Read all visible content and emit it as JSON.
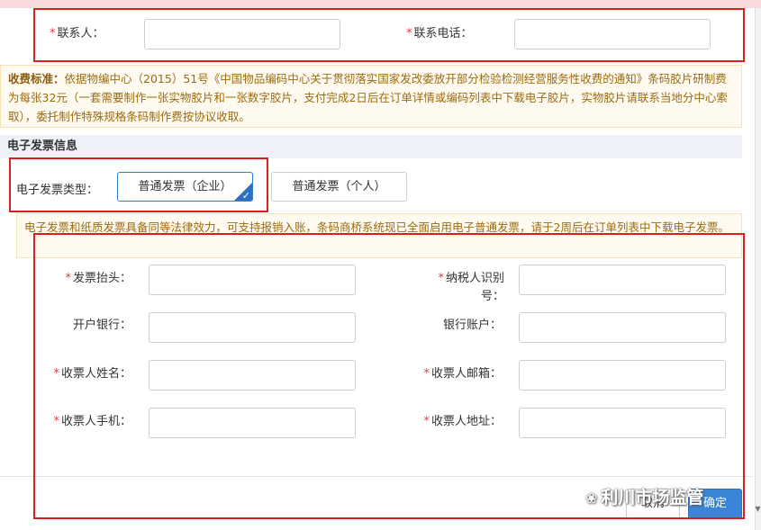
{
  "contact": {
    "name_label": "联系人：",
    "phone_label": "联系电话：",
    "name_value": "",
    "phone_value": ""
  },
  "fee_notice": {
    "title": "收费标准：",
    "body": "依据物编中心（2015）51号《中国物品编码中心关于贯彻落实国家发改委放开部分检验检测经营服务性收费的通知》条码胶片研制费为每张32元（一套需要制作一张实物胶片和一张数字胶片，支付完成2日后在订单详情或编码列表中下载电子胶片，实物胶片请联系当地分中心索取），委托制作特殊规格条码制作费按协议收取。"
  },
  "invoice": {
    "section_title": "电子发票信息",
    "type_label": "电子发票类型：",
    "options": [
      {
        "label": "普通发票（企业）",
        "selected": true
      },
      {
        "label": "普通发票（个人）",
        "selected": false
      }
    ],
    "notice": "电子发票和纸质发票具备同等法律效力，可支持报销入账，条码商桥系统现已全面启用电子普通发票，请于2周后在订单列表中下载电子发票。"
  },
  "form": {
    "title_label": "发票抬头：",
    "taxid_label_1": "纳税人识别",
    "taxid_label_2": "号：",
    "bank_label": "开户银行：",
    "account_label": "银行账户：",
    "recipient_name_label": "收票人姓名：",
    "recipient_email_label": "收票人邮箱：",
    "recipient_phone_label": "收票人手机：",
    "recipient_address_label": "收票人地址："
  },
  "footer": {
    "cancel": "取消",
    "ok": "确定"
  },
  "watermark": "利川市场监管",
  "colors": {
    "accent": "#3a85d6",
    "required": "#e4393c",
    "annotation": "#d9201c"
  }
}
